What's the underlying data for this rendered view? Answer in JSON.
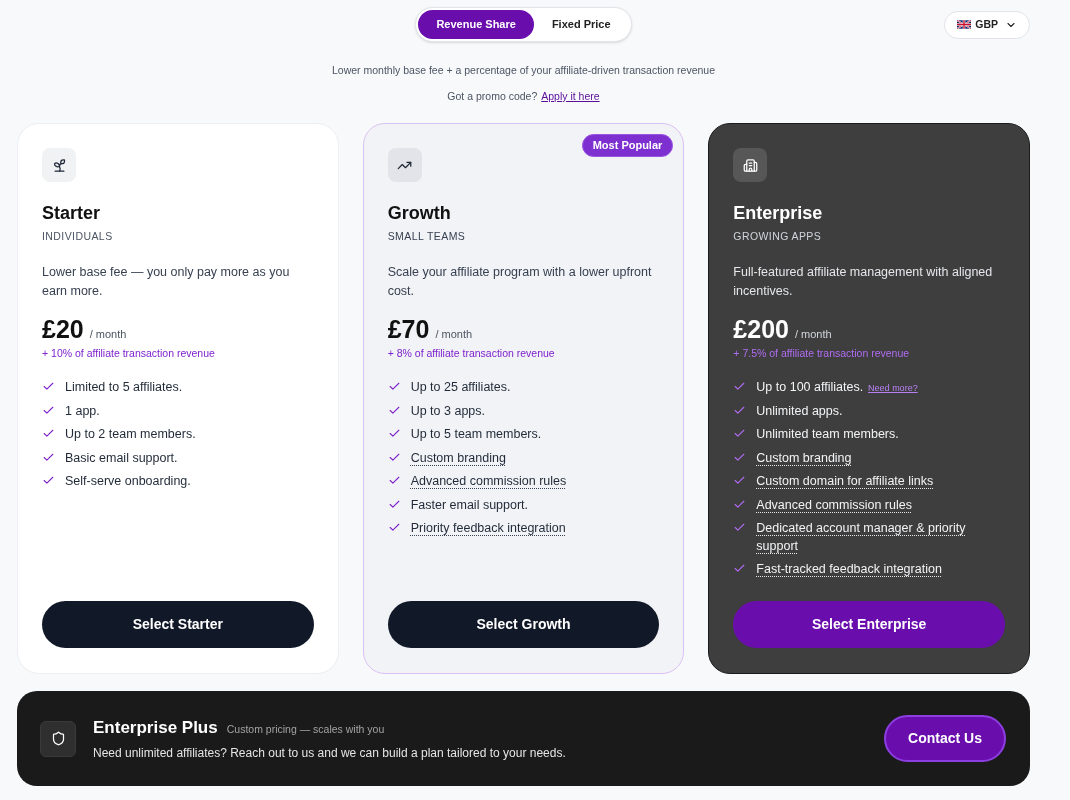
{
  "pricing_toggle": {
    "options": [
      {
        "label": "Revenue Share",
        "selected": true
      },
      {
        "label": "Fixed Price",
        "selected": false
      }
    ]
  },
  "currency_select": {
    "value": "GBP"
  },
  "subtitle": "Lower monthly base fee + a percentage of your affiliate-driven transaction revenue",
  "promo": {
    "text": "Got a promo code?",
    "link": "Apply it here"
  },
  "plans": [
    {
      "kind": "light",
      "name": "Starter",
      "audience": "INDIVIDUALS",
      "description": "Lower base fee — you only pay more as you earn more.",
      "price": "£20",
      "period": "/ month",
      "commission": "+ 10% of affiliate transaction revenue",
      "features": [
        {
          "text": "Limited to 5 affiliates.",
          "dotted": false
        },
        {
          "text": "1 app.",
          "dotted": false
        },
        {
          "text": "Up to 2 team members.",
          "dotted": false
        },
        {
          "text": "Basic email support.",
          "dotted": false
        },
        {
          "text": "Self-serve onboarding.",
          "dotted": false
        }
      ],
      "button": "Select Starter"
    },
    {
      "kind": "featured",
      "badge": "Most Popular",
      "name": "Growth",
      "audience": "SMALL TEAMS",
      "description": "Scale your affiliate program with a lower upfront cost.",
      "price": "£70",
      "period": "/ month",
      "commission": "+ 8% of affiliate transaction revenue",
      "features": [
        {
          "text": "Up to 25 affiliates.",
          "dotted": false
        },
        {
          "text": "Up to 3 apps.",
          "dotted": false
        },
        {
          "text": "Up to 5 team members.",
          "dotted": false
        },
        {
          "text": "Custom branding",
          "dotted": true
        },
        {
          "text": "Advanced commission rules",
          "dotted": true
        },
        {
          "text": "Faster email support.",
          "dotted": false
        },
        {
          "text": "Priority feedback integration",
          "dotted": true
        }
      ],
      "button": "Select Growth"
    },
    {
      "kind": "dark",
      "name": "Enterprise",
      "audience": "GROWING APPS",
      "description": "Full-featured affiliate management with aligned incentives.",
      "price": "£200",
      "period": "/ month",
      "commission": "+ 7.5% of affiliate transaction revenue",
      "features": [
        {
          "text": "Up to 100 affiliates.",
          "dotted": false,
          "link": "Need more?"
        },
        {
          "text": "Unlimited apps.",
          "dotted": false
        },
        {
          "text": "Unlimited team members.",
          "dotted": false
        },
        {
          "text": "Custom branding",
          "dotted": true
        },
        {
          "text": "Custom domain for affiliate links",
          "dotted": true
        },
        {
          "text": "Advanced commission rules",
          "dotted": true
        },
        {
          "text": "Dedicated account manager & priority support",
          "dotted": true
        },
        {
          "text": "Fast-tracked feedback integration",
          "dotted": true
        }
      ],
      "button": "Select Enterprise"
    }
  ],
  "enterprise_plus": {
    "title": "Enterprise Plus",
    "tagline": "Custom pricing — scales with you",
    "description": "Need unlimited affiliates? Reach out to us and we can build a plan tailored to your needs.",
    "button": "Contact Us"
  }
}
